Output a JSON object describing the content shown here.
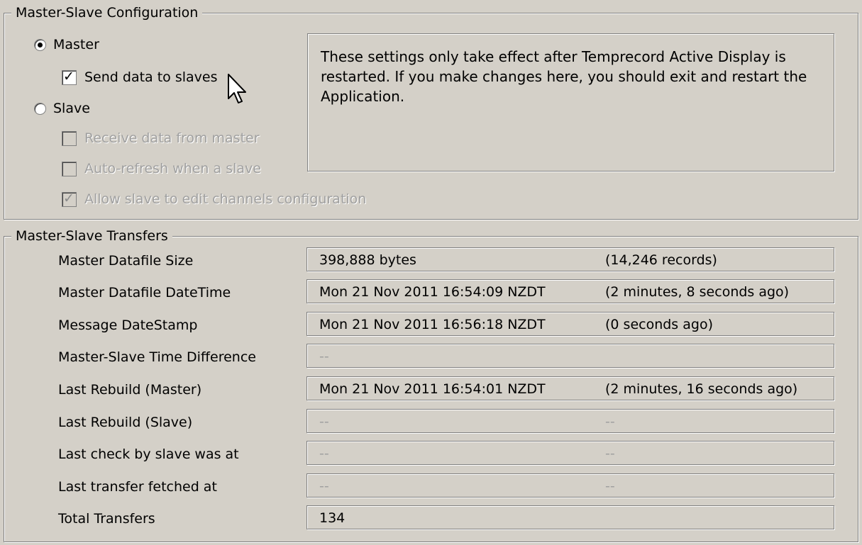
{
  "config": {
    "legend": "Master-Slave Configuration",
    "master_label": "Master",
    "send_data_label": "Send data to slaves",
    "slave_label": "Slave",
    "receive_label": "Receive data from master",
    "autorefresh_label": "Auto-refresh when a slave",
    "allow_edit_label": "Allow slave to edit channels configuration",
    "selected_mode": "Master",
    "send_data_checked": true,
    "receive_checked": false,
    "autorefresh_checked": false,
    "allow_edit_checked": true,
    "note": "These settings only take effect after Temprecord Active Display is restarted.  If you make changes here, you should exit and restart the Application."
  },
  "transfers": {
    "legend": "Master-Slave Transfers",
    "rows": [
      {
        "label": "Master Datafile Size",
        "value": "398,888 bytes",
        "extra": "(14,246 records)"
      },
      {
        "label": "Master Datafile DateTime",
        "value": "Mon 21 Nov 2011 16:54:09 NZDT",
        "extra": "(2 minutes, 8 seconds ago)"
      },
      {
        "label": "Message DateStamp",
        "value": "Mon 21 Nov 2011 16:56:18 NZDT",
        "extra": "(0 seconds ago)"
      },
      {
        "label": "Master-Slave Time Difference",
        "value": "--",
        "extra": ""
      },
      {
        "label": "Last Rebuild (Master)",
        "value": "Mon 21 Nov 2011 16:54:01 NZDT",
        "extra": "(2 minutes, 16 seconds ago)"
      },
      {
        "label": "Last Rebuild (Slave)",
        "value": "--",
        "extra": "--"
      },
      {
        "label": "Last check by slave was at",
        "value": "--",
        "extra": "--"
      },
      {
        "label": "Last transfer fetched at",
        "value": "--",
        "extra": "--"
      },
      {
        "label": "Total Transfers",
        "value": "134",
        "extra": ""
      }
    ]
  },
  "icons": {
    "cursor": "mouse-pointer-icon",
    "check": "checkmark-icon"
  }
}
